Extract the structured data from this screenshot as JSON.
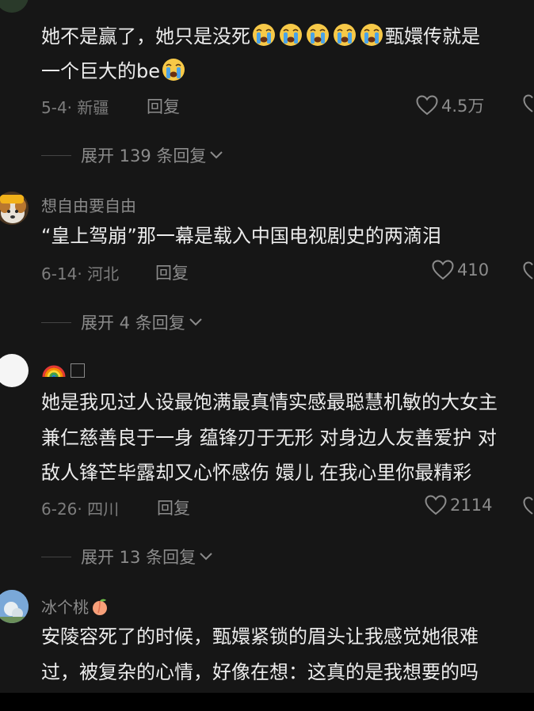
{
  "comments": [
    {
      "line1_before": "她不是赢了，她只是没死",
      "line1_after": "甄嬛传就是",
      "line2": "一个巨大的be",
      "emoji_icon": "crying-face-icon",
      "date_location": "5-4· 新疆",
      "reply_label": "回复",
      "likes": "4.5万",
      "expand_label": "展开 139 条回复"
    },
    {
      "username": "想自由要自由",
      "text": "“皇上驾崩”那一幕是载入中国电视剧史的两滴泪",
      "date_location": "6-14· 河北",
      "reply_label": "回复",
      "likes": "410",
      "expand_label": "展开 4 条回复"
    },
    {
      "username_icon": "rainbow-emoji-icon",
      "lines": [
        "她是我见过人设最饱满最真情实感最聪慧机敏的大女主",
        "兼仁慈善良于一身  蕴锋刃于无形  对身边人友善爱护  对",
        "敌人锋芒毕露却又心怀感伤  嬛儿  在我心里你最精彩"
      ],
      "date_location": "6-26· 四川",
      "reply_label": "回复",
      "likes": "2114",
      "expand_label": "展开 13 条回复"
    },
    {
      "username": "冰个桃",
      "username_emoji": "peach-emoji-icon",
      "lines": [
        "安陵容死了的时候，甄嬛紧锁的眉头让我感觉她很难",
        "过，被复杂的心情，好像在想：这真的是我想要的吗"
      ]
    }
  ],
  "colors": {
    "background": "#161616",
    "primary_text": "#ececec",
    "secondary_text": "#8c8c8c"
  }
}
